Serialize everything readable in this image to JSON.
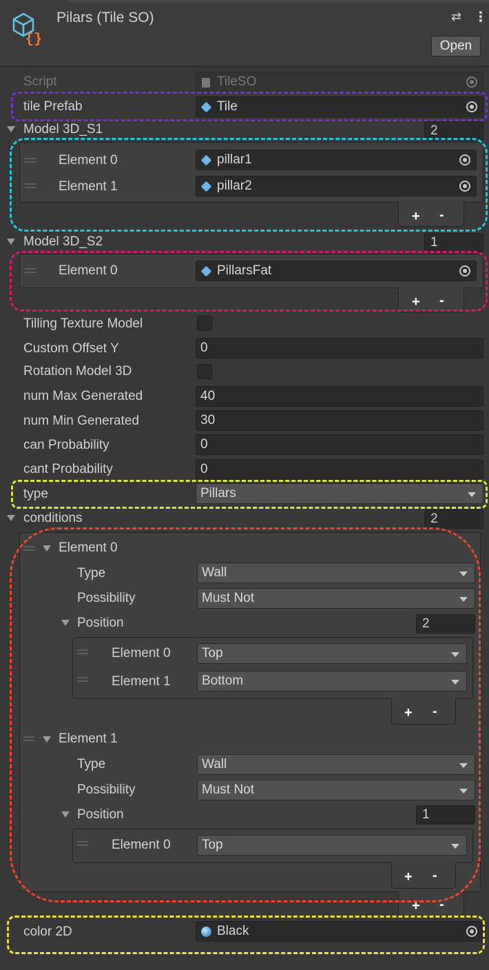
{
  "header": {
    "title": "Pilars (Tile SO)",
    "open_label": "Open",
    "icon": "scriptable-object-icon",
    "settings_icon": "preset-sliders-icon",
    "menu_icon": "kebab-menu-icon"
  },
  "fields": {
    "script": {
      "label": "Script",
      "value": "TileSO"
    },
    "tile_prefab": {
      "label": "tile Prefab",
      "value": "Tile"
    },
    "model_s1": {
      "label": "Model 3D_S1",
      "count": "2",
      "items": [
        {
          "label": "Element 0",
          "value": "pillar1"
        },
        {
          "label": "Element 1",
          "value": "pillar2"
        }
      ]
    },
    "model_s2": {
      "label": "Model 3D_S2",
      "count": "1",
      "items": [
        {
          "label": "Element 0",
          "value": "PillarsFat"
        }
      ]
    },
    "tilling": {
      "label": "Tilling Texture Model"
    },
    "offset_y": {
      "label": "Custom Offset Y",
      "value": "0"
    },
    "rotation": {
      "label": "Rotation Model 3D"
    },
    "num_max": {
      "label": "num Max Generated",
      "value": "40"
    },
    "num_min": {
      "label": "num Min Generated",
      "value": "30"
    },
    "can_prob": {
      "label": "can Probability",
      "value": "0"
    },
    "cant_prob": {
      "label": "cant Probability",
      "value": "0"
    },
    "type": {
      "label": "type",
      "value": "Pillars"
    },
    "conditions": {
      "label": "conditions",
      "count": "2",
      "elements": [
        {
          "label": "Element 0",
          "type_label": "Type",
          "type_value": "Wall",
          "possibility_label": "Possibility",
          "possibility_value": "Must Not",
          "position_label": "Position",
          "position_count": "2",
          "positions": [
            {
              "label": "Element 0",
              "value": "Top"
            },
            {
              "label": "Element 1",
              "value": "Bottom"
            }
          ]
        },
        {
          "label": "Element 1",
          "type_label": "Type",
          "type_value": "Wall",
          "possibility_label": "Possibility",
          "possibility_value": "Must Not",
          "position_label": "Position",
          "position_count": "1",
          "positions": [
            {
              "label": "Element 0",
              "value": "Top"
            }
          ]
        }
      ]
    },
    "color2d": {
      "label": "color 2D",
      "value": "Black"
    }
  },
  "list_controls": {
    "plus": "+",
    "minus": "-"
  },
  "highlight_colors": {
    "purple": "#7a2fd0",
    "cyan": "#22c8dc",
    "magenta": "#d81a6a",
    "lime": "#d8e83a",
    "orange": "#f0462a",
    "yellow": "#f0e23a"
  }
}
